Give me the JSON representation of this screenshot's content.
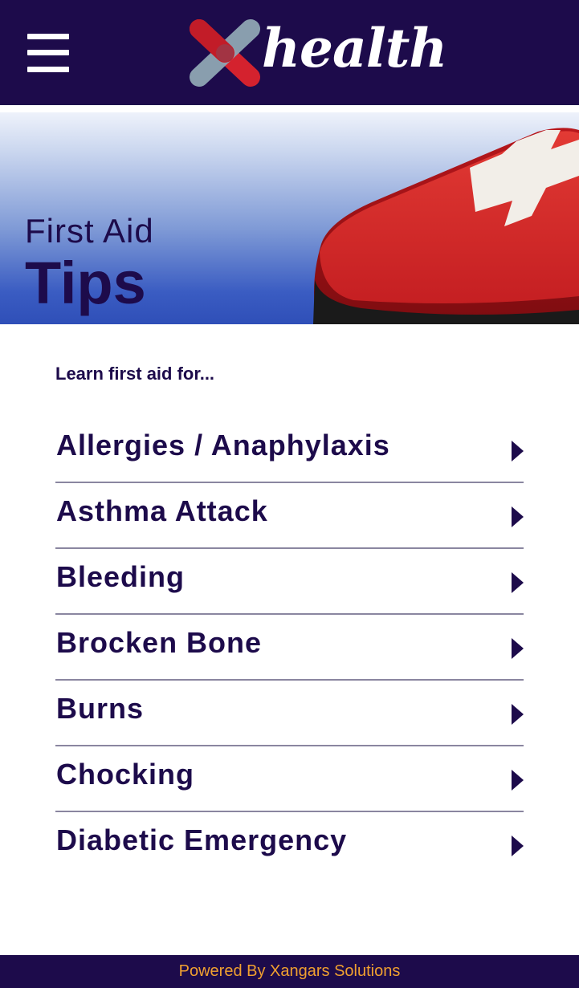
{
  "header": {
    "menu_icon": "hamburger-menu-icon",
    "logo_text": "health",
    "logo_mark_colors": [
      "#d4222e",
      "#8fa6b4"
    ]
  },
  "hero": {
    "subtitle": "First Aid",
    "title": "Tips"
  },
  "content": {
    "intro": "Learn first aid for...",
    "items": [
      {
        "label": "Allergies / Anaphylaxis",
        "icon": "chevron-right-icon"
      },
      {
        "label": "Asthma Attack",
        "icon": "chevron-right-icon"
      },
      {
        "label": "Bleeding",
        "icon": "chevron-right-icon"
      },
      {
        "label": "Brocken Bone",
        "icon": "chevron-right-icon"
      },
      {
        "label": "Burns",
        "icon": "chevron-right-icon"
      },
      {
        "label": "Chocking",
        "icon": "chevron-right-icon"
      },
      {
        "label": "Diabetic Emergency",
        "icon": "chevron-right-icon"
      }
    ]
  },
  "footer": {
    "text": "Powered By Xangars Solutions"
  },
  "colors": {
    "brand": "#1d0b4b",
    "accent": "#f0a030",
    "hero_blue": "#2f4fb8",
    "kit_red": "#d42a2a"
  }
}
